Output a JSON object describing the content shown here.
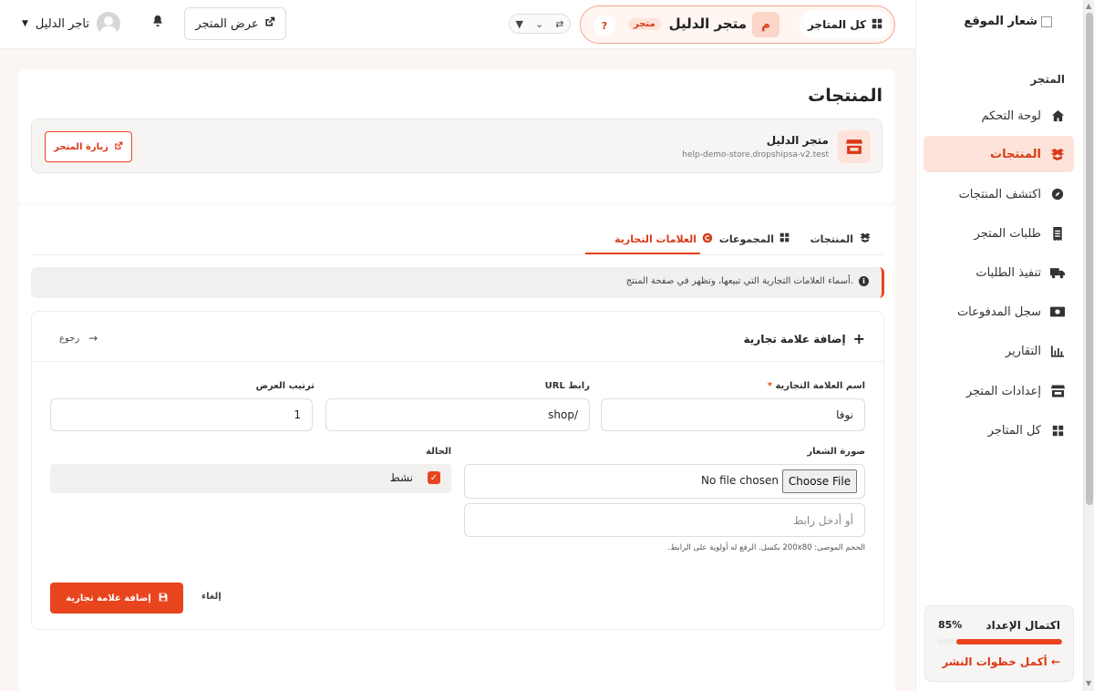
{
  "topbar": {
    "user_name": "تاجر الدليل",
    "view_store": "عرض المتجر",
    "store_name": "متجر الدليل",
    "store_badge": "متجر",
    "store_initial": "م",
    "help": "?",
    "all_stores": "كل المتاجر"
  },
  "sidebar": {
    "logo": "شعار الموقع",
    "section": "المتجر",
    "items": [
      {
        "label": "لوحة التحكم",
        "icon": "home-icon"
      },
      {
        "label": "المنتجات",
        "icon": "boxes-icon"
      },
      {
        "label": "اكتشف المنتجات",
        "icon": "compass-icon"
      },
      {
        "label": "طلبات المتجر",
        "icon": "receipt-icon"
      },
      {
        "label": "تنفيذ الطلبات",
        "icon": "truck-icon"
      },
      {
        "label": "سجل المدفوعات",
        "icon": "money-icon"
      },
      {
        "label": "التقارير",
        "icon": "chart-icon"
      },
      {
        "label": "إعدادات المتجر",
        "icon": "store-icon"
      },
      {
        "label": "كل المتاجر",
        "icon": "grid-icon"
      }
    ],
    "progress": {
      "title": "اكتمال الإعداد",
      "percent_label": "85%",
      "percent": 85,
      "link": "أكمل خطوات النشر ←"
    }
  },
  "header": {
    "title": "المنتجات",
    "store_name": "متجر الدليل",
    "store_url": "help-demo-store.dropshipsa-v2.test",
    "visit": "زيارة المتجر"
  },
  "tabs": [
    {
      "label": "المنتجات"
    },
    {
      "label": "المجموعات"
    },
    {
      "label": "العلامات التجارية"
    }
  ],
  "info": "أسماء العلامات التجارية التي تبيعها، وتظهر في صفحة المنتج.",
  "form": {
    "title": "إضافة علامة تجارية",
    "back": "رجوع",
    "brand_name_label": "اسم العلامة التجارية",
    "required_mark": "*",
    "brand_name_value": "نوفا",
    "url_label": "رابط URL",
    "url_value": "shop/",
    "order_label": "ترتيب العرض",
    "order_value": "1",
    "logo_label": "صورة الشعار",
    "file_button": "Choose File",
    "file_none": "No file chosen",
    "logo_url_placeholder": "أو أدخل رابط",
    "hint": "الحجم الموصى: 200x80 بكسل. الرفع له أولوية على الرابط.",
    "status_label": "الحالة",
    "status_value": "نشط",
    "submit": "إضافة علامة تجارية",
    "cancel": "إلغاء"
  }
}
